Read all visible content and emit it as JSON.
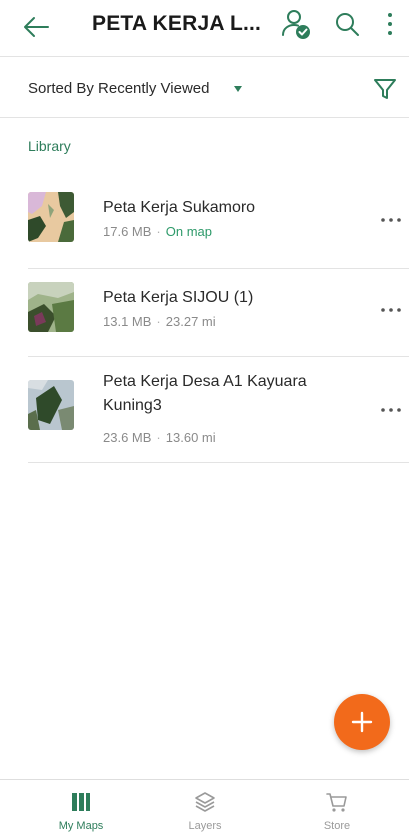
{
  "header": {
    "title": "PETA KERJA L..."
  },
  "sort": {
    "label": "Sorted By Recently Viewed"
  },
  "section": {
    "title": "Library"
  },
  "maps": [
    {
      "name": "Peta Kerja Sukamoro",
      "size": "17.6 MB",
      "separator": "·",
      "status": "On map"
    },
    {
      "name": "Peta Kerja SIJOU (1)",
      "size": "13.1 MB",
      "separator": "·",
      "status": "23.27 mi"
    },
    {
      "name": "Peta Kerja Desa A1 Kayuara Kuning3",
      "size": "23.6 MB",
      "separator": "·",
      "status": "13.60 mi"
    }
  ],
  "nav": {
    "my_maps": "My Maps",
    "layers": "Layers",
    "store": "Store"
  },
  "colors": {
    "accent": "#2e7d5b",
    "fab": "#f26a1b"
  }
}
